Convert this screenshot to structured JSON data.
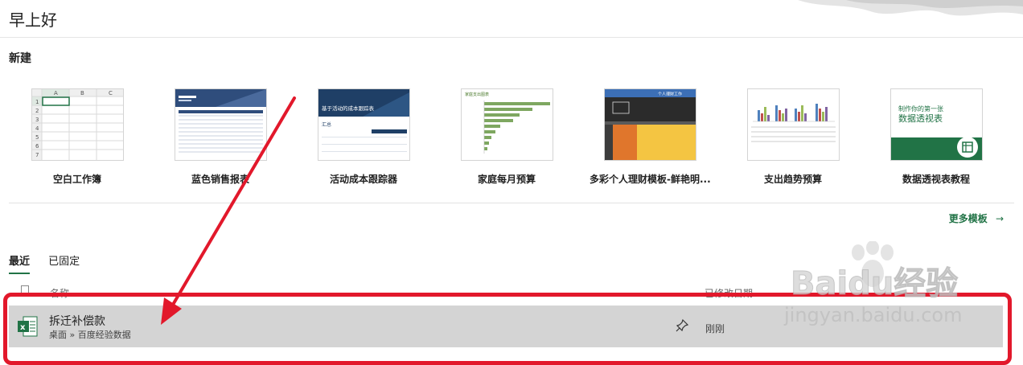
{
  "header": {
    "greeting": "早上好"
  },
  "new_section": {
    "title": "新建"
  },
  "templates": [
    {
      "label": "空白工作簿",
      "icon": "blank-workbook-thumbnail"
    },
    {
      "label": "蓝色销售报表",
      "icon": "blue-sales-report-thumbnail"
    },
    {
      "label": "活动成本跟踪器",
      "icon": "activity-cost-tracker-thumbnail",
      "thumb_title": "基于活动的成本跟踪表",
      "thumb_sub": "汇总"
    },
    {
      "label": "家庭每月预算",
      "icon": "family-budget-thumbnail",
      "thumb_title": "家庭支出图表"
    },
    {
      "label": "多彩个人理财模板-鲜艳明...",
      "icon": "personal-finance-thumbnail",
      "thumb_title": "个人理财工作"
    },
    {
      "label": "支出趋势预算",
      "icon": "expense-trend-thumbnail"
    },
    {
      "label": "数据透视表教程",
      "icon": "pivot-table-thumbnail",
      "thumb_line1": "制作你的第一张",
      "thumb_line2": "数据透视表"
    }
  ],
  "more_templates": {
    "label": "更多模板",
    "icon": "arrow-right-icon"
  },
  "tabs": [
    {
      "label": "最近",
      "active": true
    },
    {
      "label": "已固定",
      "active": false
    }
  ],
  "columns": {
    "name": "名称",
    "modified": "已修改日期"
  },
  "recent_files": [
    {
      "name": "拆迁补偿款",
      "path": "桌面 » 百度经验数据",
      "modified": "刚刚",
      "icon": "excel-file-icon"
    }
  ],
  "watermark": {
    "brand": "Baidu经验",
    "url": "jingyan.baidu.com"
  },
  "colors": {
    "accent": "#217346",
    "annotation": "#e2182b",
    "row_selected": "#d4d4d4"
  }
}
